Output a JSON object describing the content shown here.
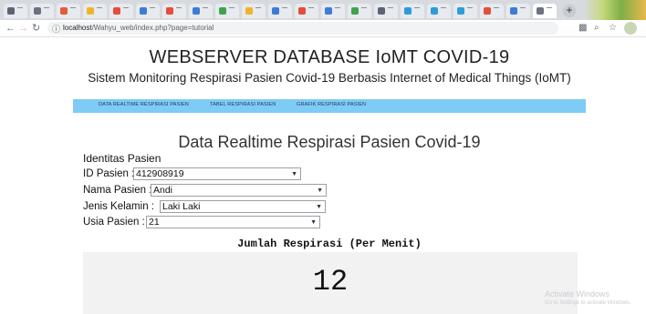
{
  "browser": {
    "url_host": "localhost",
    "url_path": "/Wahyu_web/index.php?page=tutorial",
    "new_tab_glyph": "+",
    "tabs": [
      {
        "color": "#5b6472"
      },
      {
        "color": "#6b7280"
      },
      {
        "color": "#e25c3b"
      },
      {
        "color": "#f0b429"
      },
      {
        "color": "#e74c3c"
      },
      {
        "color": "#3d7bd9"
      },
      {
        "color": "#e74c3c"
      },
      {
        "color": "#3d7bd9"
      },
      {
        "color": "#3fa34d"
      },
      {
        "color": "#f0b429"
      },
      {
        "color": "#3d7bd9"
      },
      {
        "color": "#e74c3c"
      },
      {
        "color": "#3d7bd9"
      },
      {
        "color": "#3fa34d"
      },
      {
        "color": "#5b6472"
      },
      {
        "color": "#2d9cdb"
      },
      {
        "color": "#2d9cdb"
      },
      {
        "color": "#2d9cdb"
      },
      {
        "color": "#e74c3c"
      },
      {
        "color": "#3d7bd9"
      },
      {
        "color": "#6b7280"
      }
    ],
    "icons": [
      "back-icon",
      "forward-icon",
      "reload-icon",
      "info-icon",
      "extensions-icon",
      "zoom-icon",
      "star-icon"
    ]
  },
  "page": {
    "title": "WEBSERVER DATABASE IoMT COVID-19",
    "subtitle": "Sistem Monitoring Respirasi Pasien Covid-19 Berbasis Internet of Medical Things (IoMT)",
    "menu": [
      {
        "label": "DATA REALTIME RESPIRASI PASIEN"
      },
      {
        "label": "TABEL RESPIRASI PASIEN"
      },
      {
        "label": "GRAFIK RESPIRASI PASIEN"
      }
    ],
    "section_title": "Data Realtime Respirasi Pasien Covid-19",
    "identity_heading": "Identitas Pasien",
    "fields": {
      "id_label": "ID Pasien :",
      "id_value": "412908919",
      "name_label": "Nama Pasien :",
      "name_value": "Andi",
      "gender_label": "Jenis Kelamin :",
      "gender_value": "Laki Laki",
      "age_label": "Usia Pasien :",
      "age_value": "21"
    },
    "jumlah_label": "Jumlah Respirasi (Per Menit)",
    "respiration_count": "12",
    "watermark_line1": "Activate Windows",
    "watermark_line2": "Go to Settings to activate Windows."
  },
  "colors": {
    "menu_bar": "#7ecbf6",
    "counter_bg": "#f2f2f2"
  }
}
